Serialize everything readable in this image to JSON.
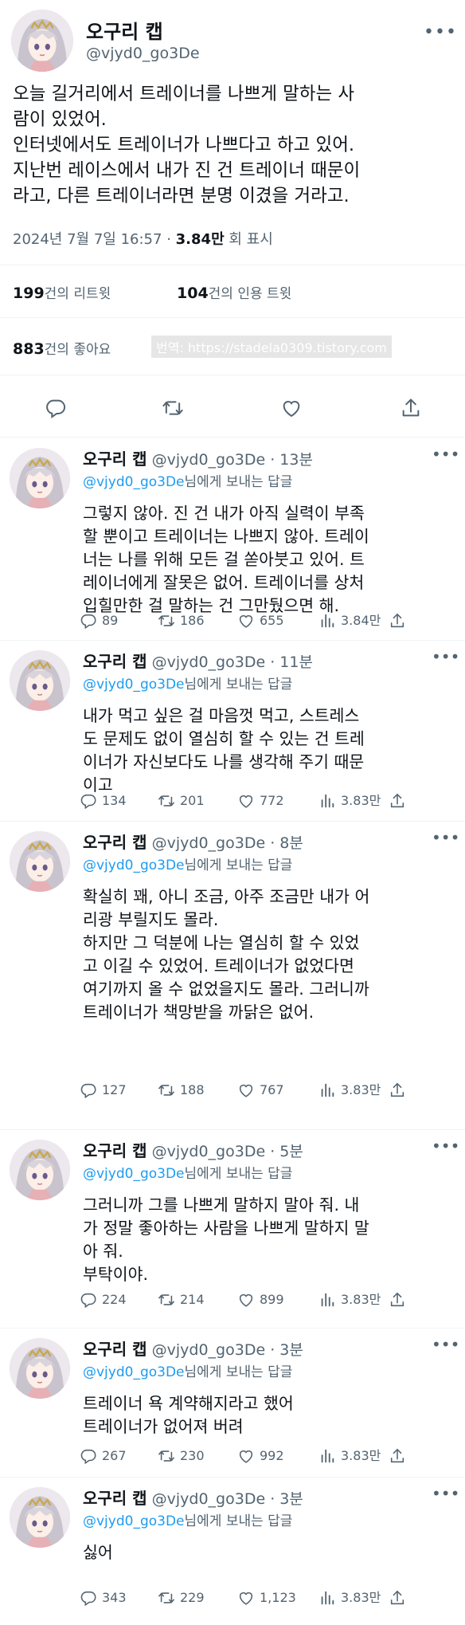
{
  "main_tweet": {
    "author_name": "오구리 캡",
    "author_handle": "@vjyd0_go3De",
    "text": "오늘 길거리에서 트레이너를 나쁘게 말하는 사\n람이 있었어.\n인터넷에서도 트레이너가 나쁘다고 하고 있어.\n지난번 레이스에서 내가 진 건 트레이너 때문이\n라고, 다른 트레이너라면 분명 이겼을 거라고.",
    "date": "2024년 7월 7일",
    "time": "16:57",
    "views_count": "3.84만",
    "views_label": "회 표시",
    "retweets_count": "199",
    "retweets_label": "건의 리트윗",
    "quotes_count": "104",
    "quotes_label": "건의 인용 트윗",
    "likes_count": "883",
    "likes_label": "건의 좋아요",
    "watermark": "번역: https://stadela0309.tistory.com"
  },
  "replies": [
    {
      "author_name": "오구리 캡",
      "author_handle": "@vjyd0_go3De",
      "time": "13분",
      "reply_to": "@vjyd0_go3De",
      "reply_suffix": "님에게 보내는 답글",
      "text": "그렇지 않아. 진 건 내가 아직 실력이 부족\n할 뿐이고 트레이너는 나쁘지 않아. 트레이\n너는 나를 위해 모든 걸 쏟아붓고 있어. 트\n레이너에게 잘못은 없어. 트레이너를 상처\n입힐만한 걸 말하는 건 그만뒀으면 해.",
      "replies": "89",
      "retweets": "186",
      "likes": "655",
      "views": "3.84만"
    },
    {
      "author_name": "오구리 캡",
      "author_handle": "@vjyd0_go3De",
      "time": "11분",
      "reply_to": "@vjyd0_go3De",
      "reply_suffix": "님에게 보내는 답글",
      "text": "내가 먹고 싶은 걸 마음껏 먹고, 스트레스\n도 문제도 없이 열심히 할 수 있는 건 트레\n이너가 자신보다도 나를 생각해 주기 때문\n이고",
      "replies": "134",
      "retweets": "201",
      "likes": "772",
      "views": "3.83만"
    },
    {
      "author_name": "오구리 캡",
      "author_handle": "@vjyd0_go3De",
      "time": "8분",
      "reply_to": "@vjyd0_go3De",
      "reply_suffix": "님에게 보내는 답글",
      "text": "확실히 꽤, 아니 조금, 아주 조금만 내가 어\n리광 부릴지도 몰라.\n하지만 그 덕분에 나는 열심히 할 수 있었\n고 이길 수 있었어. 트레이너가 없었다면\n여기까지 올 수 없었을지도 몰라. 그러니까\n트레이너가 책망받을 까닭은 없어.",
      "replies": "127",
      "retweets": "188",
      "likes": "767",
      "views": "3.83만"
    },
    {
      "author_name": "오구리 캡",
      "author_handle": "@vjyd0_go3De",
      "time": "5분",
      "reply_to": "@vjyd0_go3De",
      "reply_suffix": "님에게 보내는 답글",
      "text": "그러니까 그를 나쁘게 말하지 말아 줘. 내\n가 정말 좋아하는 사람을 나쁘게 말하지 말\n아 줘.\n부탁이야.",
      "replies": "224",
      "retweets": "214",
      "likes": "899",
      "views": "3.83만"
    },
    {
      "author_name": "오구리 캡",
      "author_handle": "@vjyd0_go3De",
      "time": "3분",
      "reply_to": "@vjyd0_go3De",
      "reply_suffix": "님에게 보내는 답글",
      "text": "트레이너  욕  계약해지라고 했어\n트레이너가 없어져 버려",
      "replies": "267",
      "retweets": "230",
      "likes": "992",
      "views": "3.83만"
    },
    {
      "author_name": "오구리 캡",
      "author_handle": "@vjyd0_go3De",
      "time": "3분",
      "reply_to": "@vjyd0_go3De",
      "reply_suffix": "님에게 보내는 답글",
      "text": "싫어",
      "replies": "343",
      "retweets": "229",
      "likes": "1,123",
      "views": "3.83만"
    }
  ],
  "icons": {
    "reply": "reply-icon",
    "retweet": "retweet-icon",
    "like": "heart-icon",
    "views": "views-chart-icon",
    "share": "share-icon",
    "more": "more-icon"
  },
  "colors": {
    "text": "#0f1419",
    "secondary": "#536471",
    "accent": "#1d9bf0",
    "divider": "#eff3f4"
  }
}
